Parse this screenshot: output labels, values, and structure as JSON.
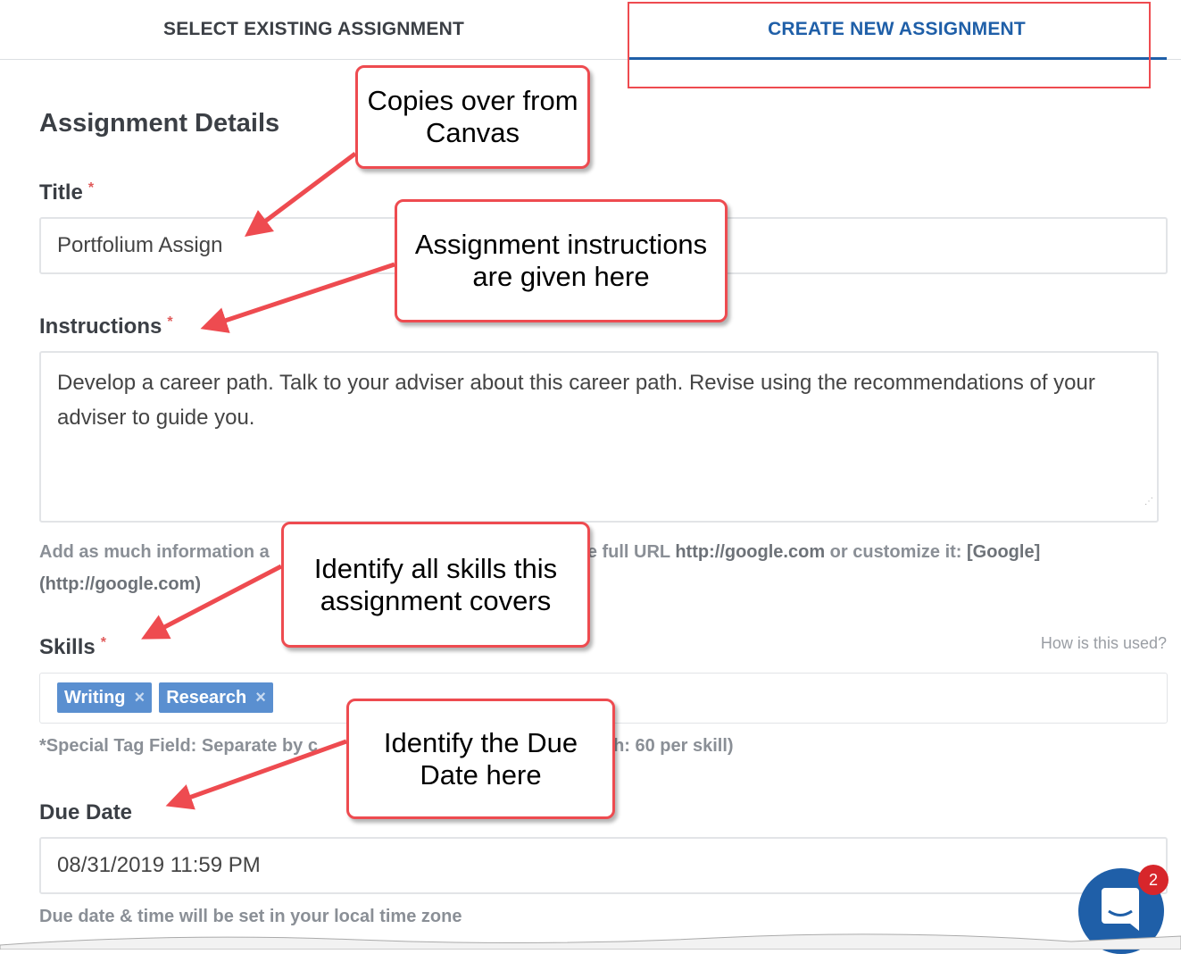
{
  "tabs": [
    {
      "label": "SELECT EXISTING ASSIGNMENT",
      "active": false
    },
    {
      "label": "CREATE NEW ASSIGNMENT",
      "active": true
    }
  ],
  "section_title": "Assignment Details",
  "title_field": {
    "label": "Title",
    "required": "*",
    "value": "Portfolium Assign"
  },
  "instructions_field": {
    "label": "Instructions",
    "required": "*",
    "value": "Develop a career path. Talk to  your adviser about this career path. Revise using the recommendations of your adviser to guide you.",
    "help_prefix": "Add as much information a",
    "help_suffix": "e full URL ",
    "help_url": "http://google.com",
    "help_mid": " or customize it: ",
    "help_custom": "[Google]",
    "help_custom2": "(http://google.com)"
  },
  "skills_field": {
    "label": "Skills",
    "required": "*",
    "how_link": "How is this used?",
    "tags": [
      "Writing",
      "Research"
    ],
    "remove_icon": "×",
    "help_prefix": "*Special Tag Field: Separate by c",
    "help_suffix": "ngth: 60 per skill)"
  },
  "due_date_field": {
    "label": "Due Date",
    "value": "08/31/2019 11:59 PM",
    "help": "Due date & time will be set in your local time zone"
  },
  "chat": {
    "icon": "chat-bubble-icon",
    "badge": "2"
  },
  "callouts": [
    "Copies over from Canvas",
    "Assignment instructions are given here",
    "Identify all skills this assignment covers",
    "Identify the Due Date here"
  ],
  "colors": {
    "accent": "#1f5fa8",
    "annotation": "#ee4b50",
    "tag": "#5a8fd0",
    "badge": "#d7262b"
  }
}
